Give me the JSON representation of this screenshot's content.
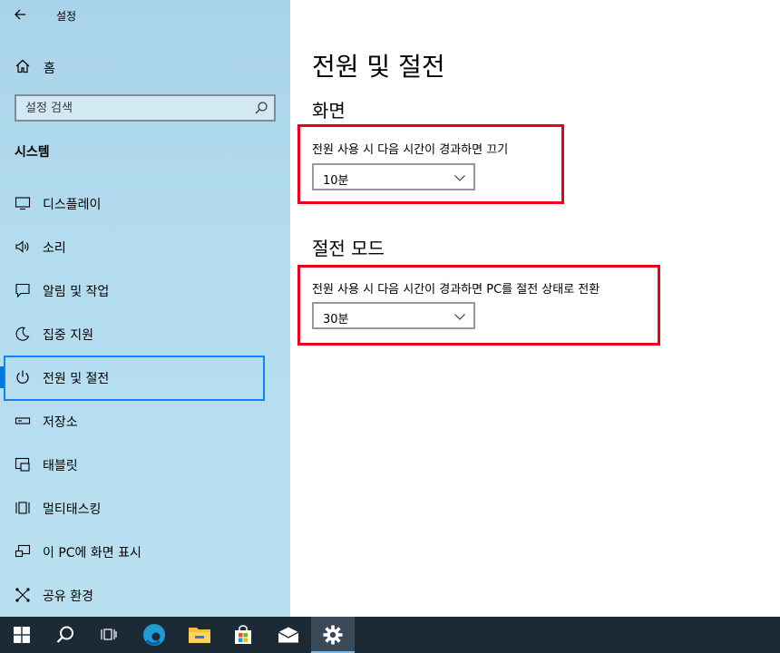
{
  "window": {
    "title": "설정",
    "back_label": "←"
  },
  "sidebar": {
    "home_label": "홈",
    "search_placeholder": "설정 검색",
    "section_title": "시스템",
    "items": [
      {
        "label": "디스플레이",
        "icon": "display-icon"
      },
      {
        "label": "소리",
        "icon": "speaker-icon"
      },
      {
        "label": "알림 및 작업",
        "icon": "notification-icon"
      },
      {
        "label": "집중 지원",
        "icon": "moon-icon"
      },
      {
        "label": "전원 및 절전",
        "icon": "power-icon",
        "selected": true
      },
      {
        "label": "저장소",
        "icon": "storage-icon"
      },
      {
        "label": "태블릿",
        "icon": "tablet-icon"
      },
      {
        "label": "멀티태스킹",
        "icon": "multitasking-icon"
      },
      {
        "label": "이 PC에 화면 표시",
        "icon": "project-icon"
      },
      {
        "label": "공유 환경",
        "icon": "shared-experience-icon"
      }
    ]
  },
  "main": {
    "title": "전원 및 절전",
    "screen": {
      "heading": "화면",
      "label": "전원 사용 시 다음 시간이 경과하면 끄기",
      "value": "10분"
    },
    "sleep": {
      "heading": "절전 모드",
      "label": "전원 사용 시 다음 시간이 경과하면 PC를 절전 상태로 전환",
      "value": "30분"
    }
  },
  "colors": {
    "accent": "#0078d7",
    "highlight": "#e8001c",
    "focus": "#0a84ff",
    "taskbar": "#1c2a36"
  },
  "taskbar": [
    "windows-start-icon",
    "search-icon",
    "task-view-icon",
    "edge-icon",
    "file-explorer-icon",
    "store-icon",
    "mail-icon",
    "settings-gear-icon"
  ]
}
